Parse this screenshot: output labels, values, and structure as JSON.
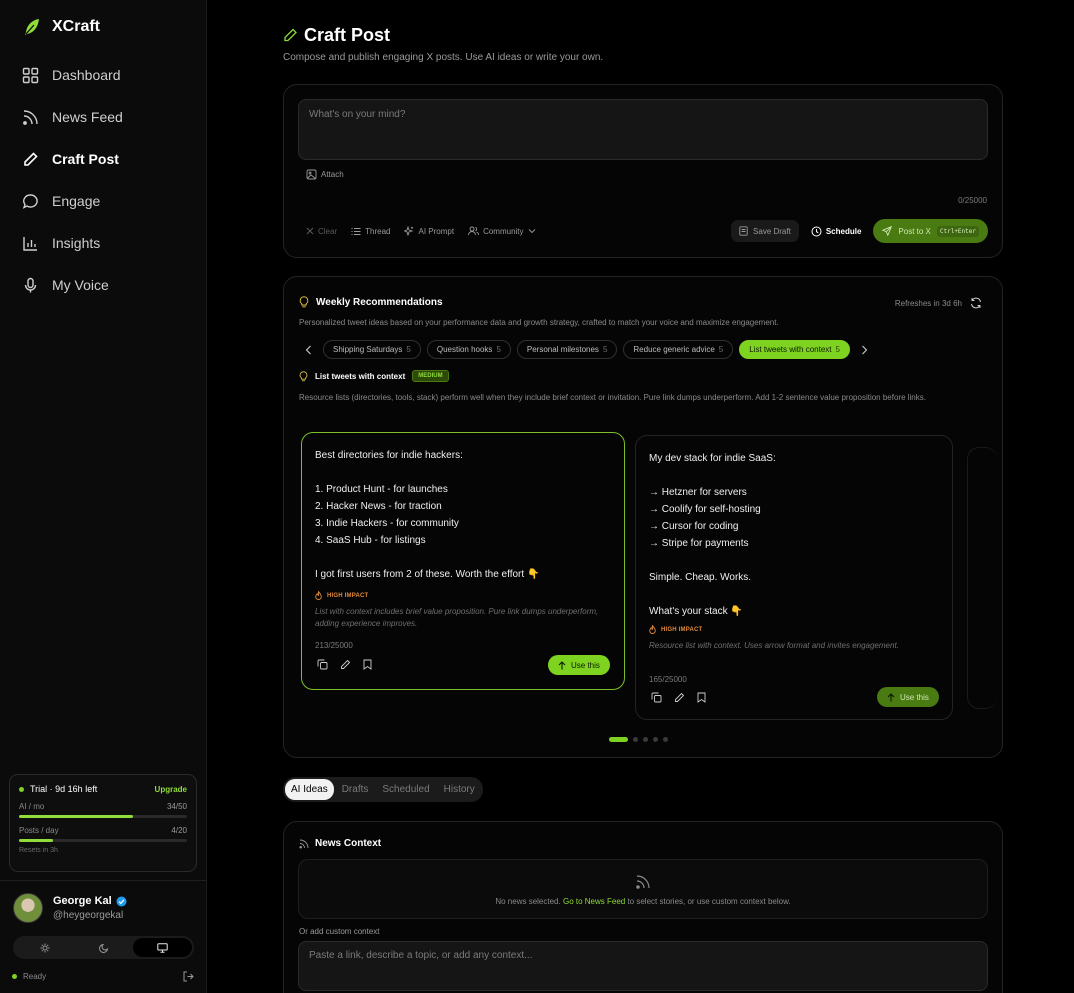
{
  "brand": {
    "name": "XCraft"
  },
  "nav": {
    "dashboard": "Dashboard",
    "news_feed": "News Feed",
    "craft_post": "Craft Post",
    "engage": "Engage",
    "insights": "Insights",
    "my_voice": "My Voice"
  },
  "trial": {
    "label": "Trial · 9d 16h left",
    "upgrade": "Upgrade",
    "ai_label": "AI / mo",
    "ai_value": "34/50",
    "ai_fraction": 0.68,
    "posts_label": "Posts / day",
    "posts_value": "4/20",
    "posts_fraction": 0.2,
    "resets": "Resets in 3h"
  },
  "user": {
    "name": "George Kal",
    "handle": "@heygeorgekal"
  },
  "status": {
    "label": "Ready"
  },
  "page": {
    "title": "Craft Post",
    "subtitle": "Compose and publish engaging X posts. Use AI ideas or write your own."
  },
  "composer": {
    "placeholder": "What's on your mind?",
    "attach": "Attach",
    "count": "0/25000",
    "clear": "Clear",
    "thread": "Thread",
    "ai_prompt": "AI Prompt",
    "community": "Community",
    "save_draft": "Save Draft",
    "schedule": "Schedule",
    "post": "Post to X",
    "shortcut": "Ctrl+Enter"
  },
  "reco": {
    "title": "Weekly Recommendations",
    "refreshes": "Refreshes in 3d 6h",
    "description": "Personalized tweet ideas based on your performance data and growth strategy, crafted to match your voice and maximize engagement.",
    "chips": [
      {
        "label": "Shipping Saturdays",
        "count": "5"
      },
      {
        "label": "Question hooks",
        "count": "5"
      },
      {
        "label": "Personal milestones",
        "count": "5"
      },
      {
        "label": "Reduce generic advice",
        "count": "5"
      },
      {
        "label": "List tweets with context",
        "count": "5"
      }
    ],
    "topic": "List tweets with context",
    "topic_badge": "MEDIUM",
    "topic_desc": "Resource lists (directories, tools, stack) perform well when they include brief context or invitation. Pure link dumps underperform. Add 1-2 sentence value proposition before links.",
    "cards": [
      {
        "lines": [
          "Best directories for indie hackers:",
          "",
          "1. Product Hunt - for launches",
          "2. Hacker News - for traction",
          "3. Indie Hackers - for community",
          "4. SaaS Hub - for listings",
          "",
          "I got first users from 2 of these. Worth the effort 👇"
        ],
        "impact": "HIGH IMPACT",
        "why": "List with context includes brief value proposition. Pure link dumps underperform, adding experience improves.",
        "count": "213/25000",
        "use": "Use this"
      },
      {
        "lines": [
          "My dev stack for indie SaaS:",
          "",
          "→ Hetzner for servers",
          "→ Coolify for self-hosting",
          "→ Cursor for coding",
          "→ Stripe for payments",
          "",
          "Simple. Cheap. Works.",
          "",
          "What's your stack 👇"
        ],
        "impact": "HIGH IMPACT",
        "why": "Resource list with context. Uses arrow format and invites engagement.",
        "count": "165/25000",
        "use": "Use this"
      }
    ]
  },
  "tabs": {
    "ai_ideas": "AI Ideas",
    "drafts": "Drafts",
    "scheduled": "Scheduled",
    "history": "History"
  },
  "news": {
    "title": "News Context",
    "empty_pre": "No news selected.",
    "empty_link": "Go to News Feed",
    "empty_post": "to select stories, or use custom context below.",
    "custom_label": "Or add custom context",
    "custom_placeholder": "Paste a link, describe a topic, or add any context..."
  },
  "colors": {
    "accent": "#7ed321",
    "accent_dark": "#4a7a12",
    "impact": "#e28a3a"
  }
}
